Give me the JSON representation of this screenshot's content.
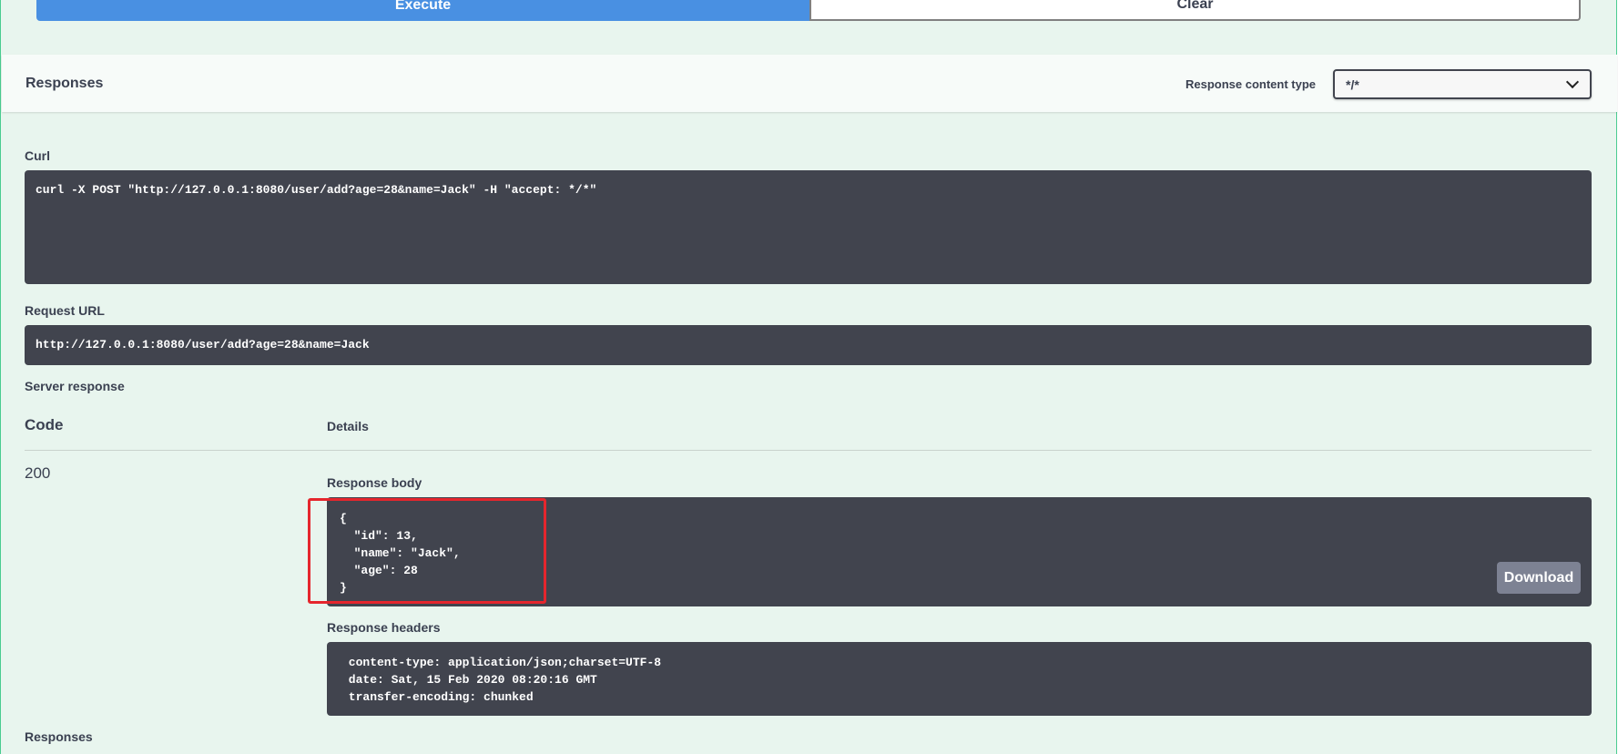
{
  "buttons": {
    "execute": "Execute",
    "clear": "Clear"
  },
  "responses_section": {
    "title": "Responses",
    "content_type_label": "Response content type",
    "content_type_value": "*/*"
  },
  "curl": {
    "label": "Curl",
    "command": "curl -X POST \"http://127.0.0.1:8080/user/add?age=28&name=Jack\" -H \"accept: */*\""
  },
  "request_url": {
    "label": "Request URL",
    "value": "http://127.0.0.1:8080/user/add?age=28&name=Jack"
  },
  "server_response": {
    "label": "Server response",
    "code_header": "Code",
    "details_header": "Details",
    "code": "200",
    "body_label": "Response body",
    "body": "{\n  \"id\": 13,\n  \"name\": \"Jack\",\n  \"age\": 28\n}",
    "download_label": "Download",
    "headers_label": "Response headers",
    "headers": " content-type: application/json;charset=UTF-8 \n date: Sat, 15 Feb 2020 08:20:16 GMT \n transfer-encoding: chunked "
  },
  "footer": {
    "responses_label": "Responses"
  },
  "colors": {
    "execute": "#4990e2",
    "block_bg": "#e8f5ee",
    "code_bg": "#41444e",
    "highlight": "#e5262d"
  }
}
